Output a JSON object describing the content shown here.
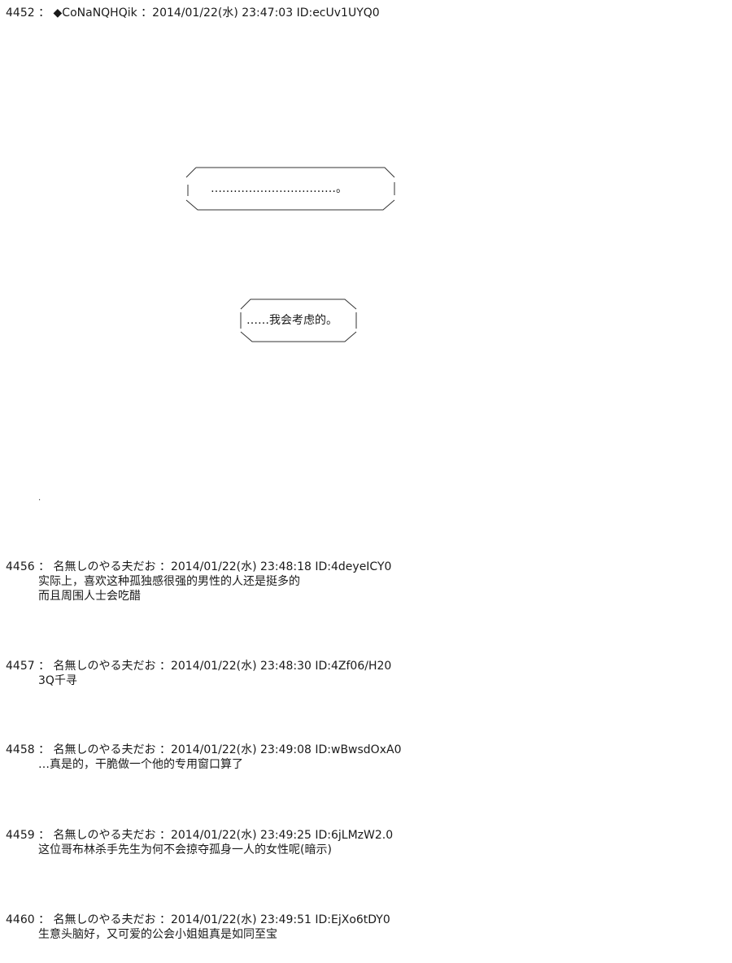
{
  "posts": [
    {
      "header": "4452 ： ◆CoNaNQHQik ：2014/01/22(水) 23:47:03 ID:ecUv1UYQ0",
      "bubbles": [
        "……………………………。",
        "……我会考虑的。"
      ],
      "dot": "."
    },
    {
      "header": "4456 ： 名無しのやる夫だお ：2014/01/22(水) 23:48:18 ID:4deyeICY0",
      "lines": [
        "实际上，喜欢这种孤独感很强的男性的人还是挺多的",
        "而且周围人士会吃醋"
      ]
    },
    {
      "header": "4457 ： 名無しのやる夫だお ：2014/01/22(水) 23:48:30 ID:4Zf06/H20",
      "lines": [
        "3Q千寻"
      ]
    },
    {
      "header": "4458 ： 名無しのやる夫だお ：2014/01/22(水) 23:49:08 ID:wBwsdOxA0",
      "lines": [
        "…真是的，干脆做一个他的专用窗口算了"
      ]
    },
    {
      "header": "4459 ： 名無しのやる夫だお ：2014/01/22(水) 23:49:25 ID:6jLMzW2.0",
      "lines": [
        "这位哥布林杀手先生为何不会掠夺孤身一人的女性呢(暗示)"
      ]
    },
    {
      "header": "4460 ： 名無しのやる夫だお ：2014/01/22(水) 23:49:51 ID:EjXo6tDY0",
      "lines": [
        "生意头脑好，又可爱的公会小姐姐真是如同至宝"
      ]
    }
  ]
}
